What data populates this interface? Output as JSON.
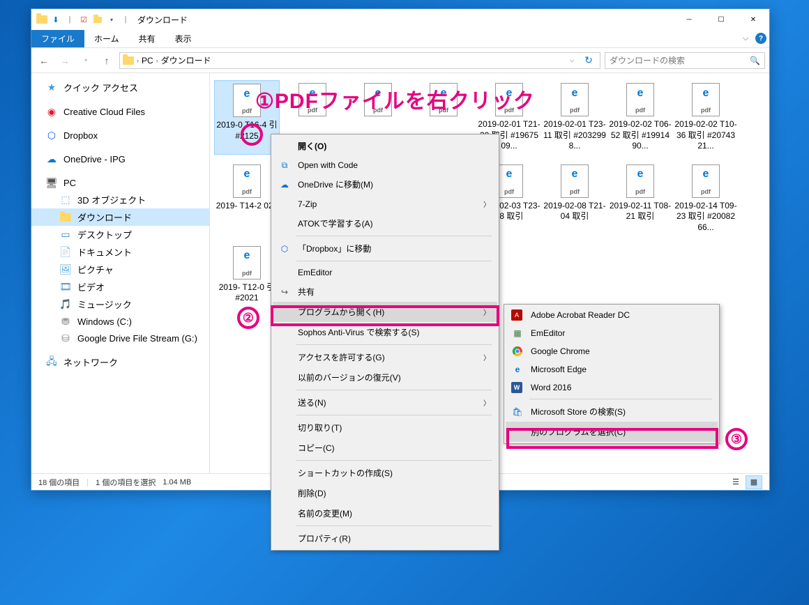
{
  "window": {
    "title": "ダウンロード",
    "tabs": {
      "file": "ファイル",
      "home": "ホーム",
      "share": "共有",
      "view": "表示"
    }
  },
  "address": {
    "root": "PC",
    "folder": "ダウンロード"
  },
  "search": {
    "placeholder": "ダウンロードの検索"
  },
  "sidebar": {
    "quick": "クイック アクセス",
    "ccf": "Creative Cloud Files",
    "dropbox": "Dropbox",
    "onedrive": "OneDrive - IPG",
    "pc": "PC",
    "threed": "3D オブジェクト",
    "downloads": "ダウンロード",
    "desktop": "デスクトップ",
    "documents": "ドキュメント",
    "pictures": "ピクチャ",
    "videos": "ビデオ",
    "music": "ミュージック",
    "windowsc": "Windows (C:)",
    "gdrive": "Google Drive File Stream (G:)",
    "network": "ネットワーク"
  },
  "files": {
    "r1": [
      "2019-0   T16-4   引 #2125",
      "",
      "",
      "",
      "2019-02-01 T21-30 取引 #1967509...",
      "2019-02-01 T23-11 取引 #2032998...",
      "2019-02-02 T06-52 取引 #1991490...",
      "2019-02-02 T10-36 取引 #2074321..."
    ],
    "r2": [
      "2019-   T14-2   028",
      "",
      "",
      "",
      "2019-02-03 T23-08 取引",
      "2019-02-08 T21-04 取引",
      "2019-02-11 T08-21 取引",
      "2019-02-14 T09-23 取引 #2008266..."
    ],
    "r3": [
      "2019-   T12-0   引 #2021"
    ]
  },
  "status": {
    "count": "18 個の項目",
    "selected": "1 個の項目を選択",
    "size": "1.04 MB"
  },
  "context": {
    "open": "開く(O)",
    "openCode": "Open with Code",
    "onedriveMove": "OneDrive に移動(M)",
    "sevenZip": "7-Zip",
    "atok": "ATOKで学習する(A)",
    "dropboxMove": "「Dropbox」に移動",
    "emeditor": "EmEditor",
    "share": "共有",
    "openWith": "プログラムから開く(H)",
    "sophos": "Sophos Anti-Virus で検索する(S)",
    "access": "アクセスを許可する(G)",
    "prevVersion": "以前のバージョンの復元(V)",
    "sendTo": "送る(N)",
    "cut": "切り取り(T)",
    "copy": "コピー(C)",
    "shortcut": "ショートカットの作成(S)",
    "delete": "削除(D)",
    "rename": "名前の変更(M)",
    "properties": "プロパティ(R)"
  },
  "submenu": {
    "acrobat": "Adobe Acrobat Reader DC",
    "emeditor": "EmEditor",
    "chrome": "Google Chrome",
    "edge": "Microsoft Edge",
    "word": "Word 2016",
    "store": "Microsoft Store の検索(S)",
    "choose": "別のプログラムを選択(C)"
  },
  "annotations": {
    "step1": "①PDFファイルを右クリック",
    "step2": "②",
    "step3": "③"
  }
}
